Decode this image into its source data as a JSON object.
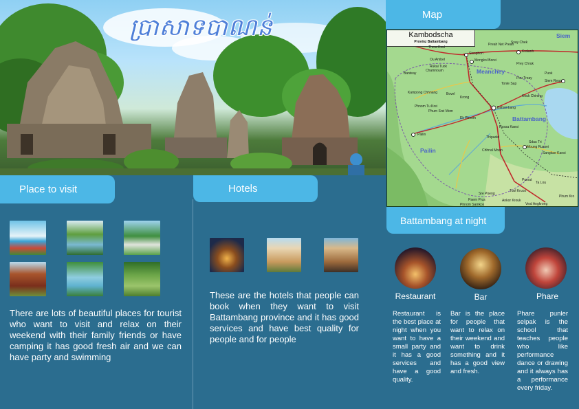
{
  "hero": {
    "title": "ប្រាសាទបាណន់"
  },
  "sections": {
    "visit": {
      "tab_label": "Place to visit",
      "description": "There are lots of beautiful places for tourist who want to visit and relax on their weekend with their family friends or have camping it has good fresh air and we can have party and swimming"
    },
    "hotels": {
      "tab_label": "Hotels",
      "description": "These are the hotels that people can book when they want to visit Battambang province and it has good services and have best quality for people and for people"
    },
    "map": {
      "tab_label": "Map",
      "label_title": "Kambodscha",
      "label_subtitle": "Provinz Battambang",
      "regions": [
        "Meanchey",
        "Battambang",
        "Pailin",
        "Siem"
      ],
      "towns": [
        "Sisophon",
        "Mongkol Borei",
        "Kralanh",
        "Siem Reap",
        "Battambang",
        "Pailin",
        "Moung Russei",
        "Thma Koul",
        "Ou Ambel",
        "Rukai Tuok",
        "Chamnoum",
        "Banteay",
        "Kampong Chhnang",
        "Phnom Tu Krei",
        "Phum Srei Mom",
        "Bovel",
        "Krong",
        "Ek Phnom",
        "Svay Chek",
        "Preah Net Preah",
        "Puok",
        "Prey Chruk",
        "Pou Treay",
        "Kouk Chining",
        "Tonle Sap",
        "Thipadei",
        "Rossa Kaesi",
        "Chhnal Moan",
        "Sdau Tri",
        "Sangkae Kaesi",
        "Pursat",
        "Ta Lou",
        "Tuol Kruos",
        "Ankor Krouk",
        "Veal Angkrong",
        "Phum Kro",
        "Phnom Samkos",
        "Sre Poeng",
        "Paem Prus"
      ]
    },
    "night": {
      "tab_label": "Battambang at night",
      "items": [
        {
          "caption": "Restaurant",
          "description": "Restaurant is the best place at night when you want to have a small party and it has a good services and have a good quality."
        },
        {
          "caption": "Bar",
          "description": "Bar is the place for people that want to relax on their weekend and want to drink something and it has a good view and fresh."
        },
        {
          "caption": "Phare",
          "description": "Phare punler selpak is the school that teaches people who like performance dance or drawing and it always has a performance every friday."
        }
      ]
    }
  },
  "colors": {
    "background": "#2b6d8f",
    "tab": "#4cb7e6",
    "map_land": "#9fd38a",
    "map_water": "#a9d8f0",
    "map_road": "#c0282b",
    "map_region_text": "#4a63c8"
  }
}
